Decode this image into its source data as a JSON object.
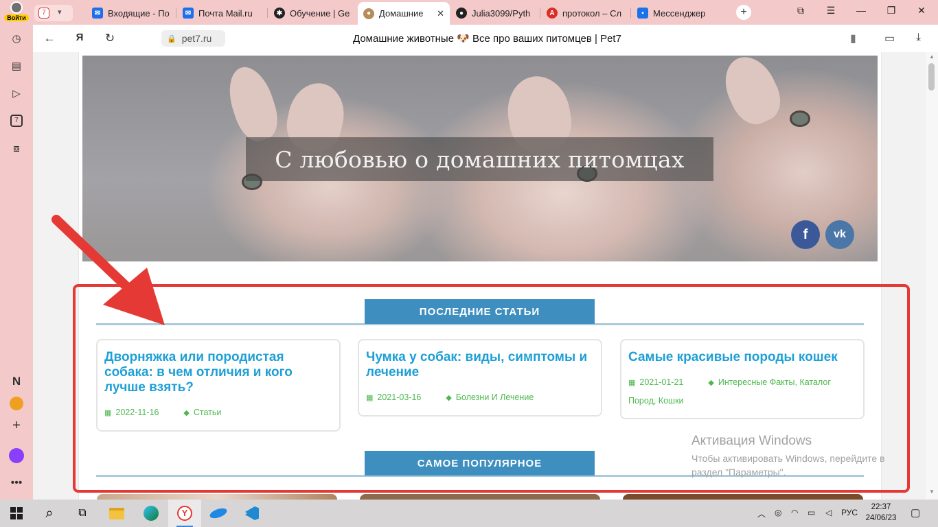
{
  "browser": {
    "profile_label": "Войти",
    "tab_count": "7",
    "tabs": [
      {
        "label": "Входящие - По",
        "icon": "mail-icon",
        "color": "#1f6feb"
      },
      {
        "label": "Почта Mail.ru",
        "icon": "mail-icon",
        "color": "#1f6feb"
      },
      {
        "label": "Обучение | Ge",
        "icon": "openai-icon",
        "color": "#222222"
      },
      {
        "label": "Домашние",
        "icon": "pug-icon",
        "color": "#b78b5a",
        "active": true
      },
      {
        "label": "Julia3099/Pyth",
        "icon": "github-icon",
        "color": "#222222"
      },
      {
        "label": "протокол – Сл",
        "icon": "translate-icon",
        "color": "#d93025"
      },
      {
        "label": "Мессенджер",
        "icon": "messenger-icon",
        "color": "#1a73e8"
      }
    ],
    "url": "pet7.ru",
    "page_title": "Домашние животные 🐶 Все про ваших питомцев | Pet7"
  },
  "hero": {
    "title": "С любовью о домашних питомцах",
    "social": [
      {
        "name": "facebook",
        "glyph": "f",
        "color": "#3b5998"
      },
      {
        "name": "vk",
        "glyph": "vk",
        "color": "#4a76a8"
      }
    ]
  },
  "latest": {
    "heading": "ПОСЛЕДНИЕ СТАТЬИ",
    "articles": [
      {
        "title": "Дворняжка или породистая собака: в чем отличия и кого лучше взять?",
        "date": "2022-11-16",
        "tags": "Статьи"
      },
      {
        "title": "Чумка у собак: виды, симптомы и лечение",
        "date": "2021-03-16",
        "tags": "Болезни И Лечение"
      },
      {
        "title": "Самые красивые породы кошек",
        "date": "2021-01-21",
        "tags": "Интересные Факты, Каталог Пород, Кошки"
      }
    ]
  },
  "popular": {
    "heading": "САМОЕ ПОПУЛЯРНОЕ"
  },
  "watermark": {
    "title": "Активация Windows",
    "text": "Чтобы активировать Windows, перейдите в раздел \"Параметры\"."
  },
  "taskbar": {
    "lang": "РУС",
    "time": "22:37",
    "date": "24/06/23"
  },
  "colors": {
    "accent_blue": "#3e8fbf",
    "link_blue": "#1e9fd6",
    "meta_green": "#4cb84c",
    "annotation_red": "#e53935"
  }
}
